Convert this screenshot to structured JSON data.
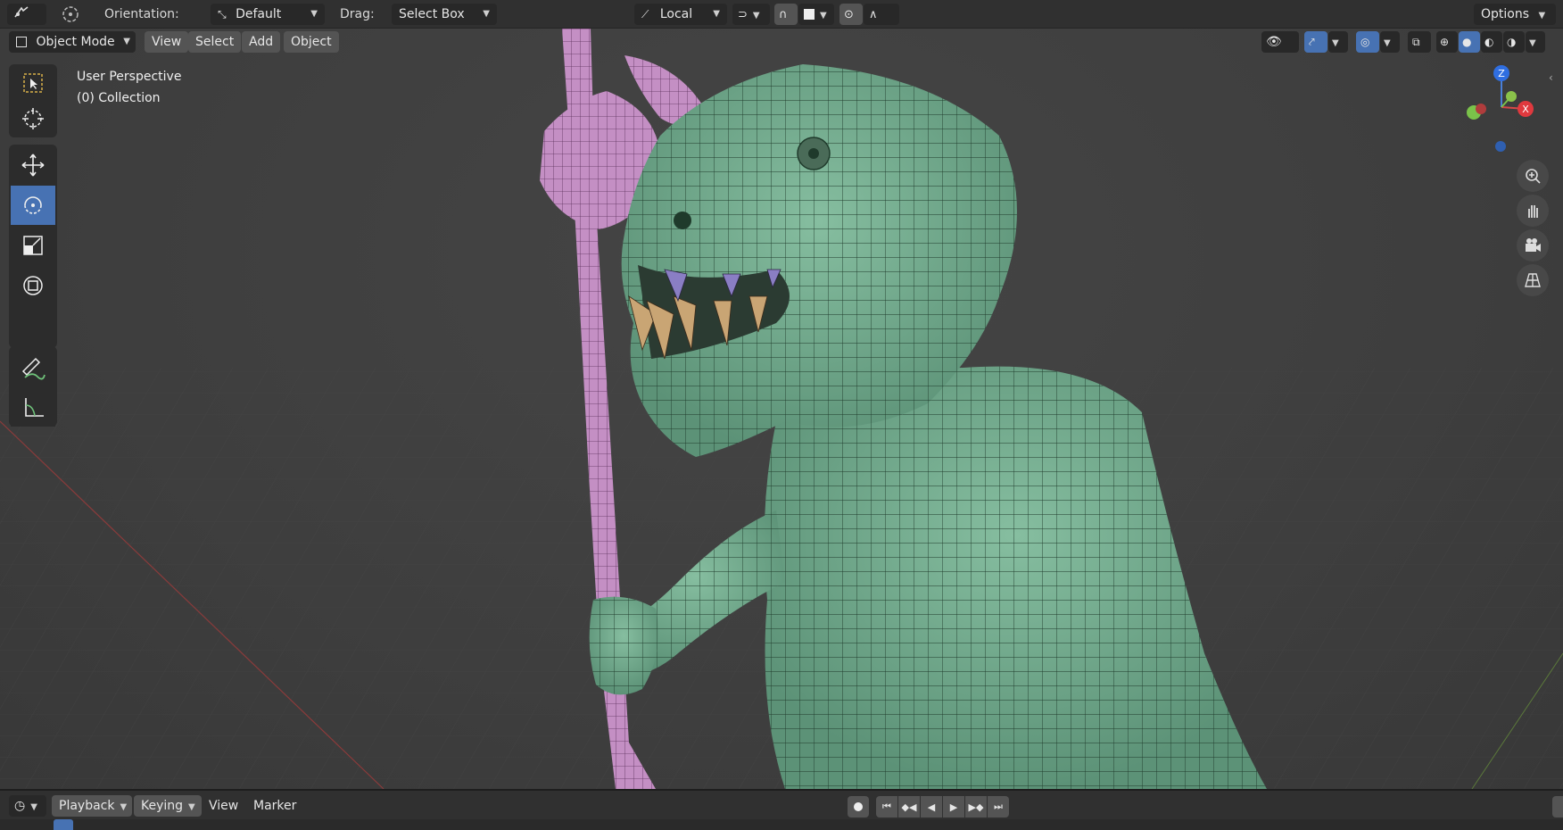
{
  "topbar": {
    "orientation_label": "Orientation:",
    "orientation_value": "Default",
    "drag_label": "Drag:",
    "drag_value": "Select Box",
    "pivot_value": "Local",
    "options_label": "Options"
  },
  "header": {
    "mode": "Object Mode",
    "menus": [
      "View",
      "Select",
      "Add",
      "Object"
    ]
  },
  "viewport": {
    "view_name": "User Perspective",
    "collection": "(0) Collection",
    "gizmo": {
      "z": "Z",
      "x": "X"
    }
  },
  "toolbar": {
    "tools": [
      "select-box",
      "cursor",
      "move",
      "rotate",
      "scale",
      "transform",
      "annotate",
      "measure"
    ],
    "active_tool": "rotate"
  },
  "timeline": {
    "playback_label": "Playback",
    "keying_label": "Keying",
    "view_label": "View",
    "marker_label": "Marker"
  },
  "colors": {
    "accent": "#4772b3",
    "creature": "#6fa88a",
    "staff": "#c08ac0"
  }
}
